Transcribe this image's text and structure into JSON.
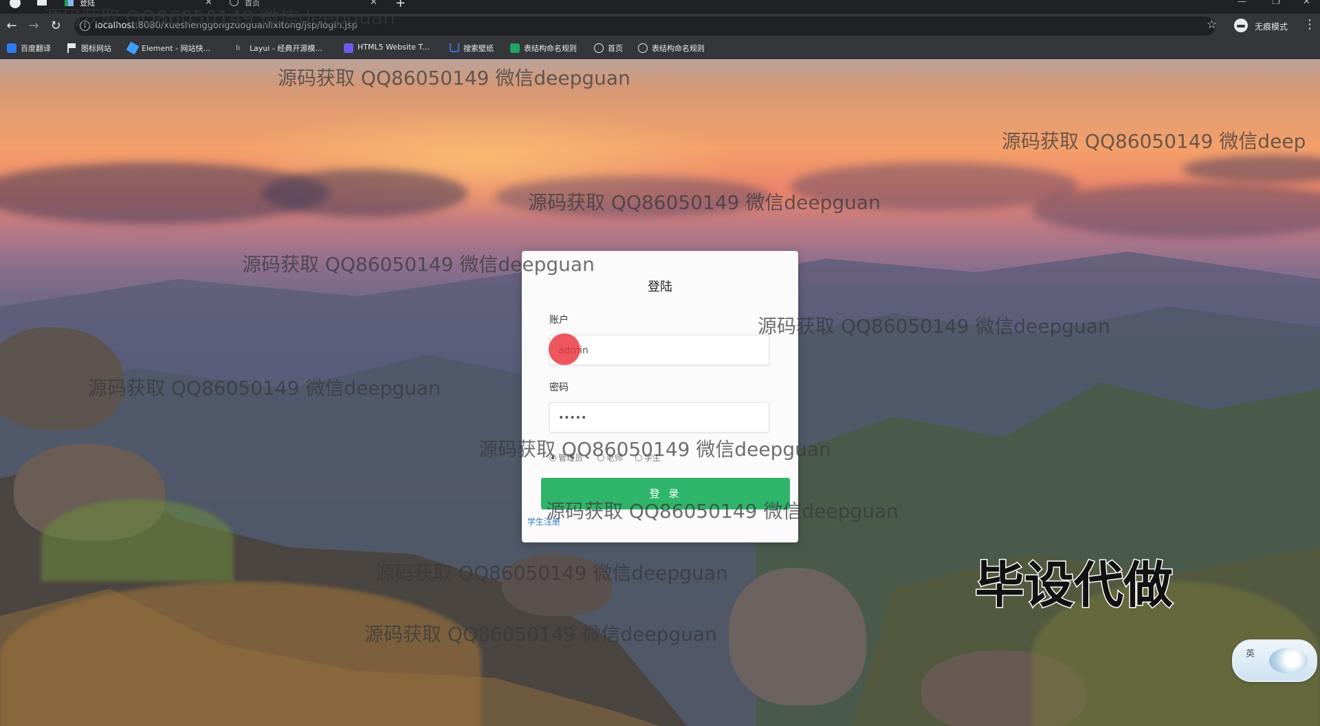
{
  "browser": {
    "tabs": [
      {
        "label": "登陆",
        "active": true
      },
      {
        "label": "首页",
        "active": false
      }
    ],
    "url_host": "localhost",
    "url_rest": ":8080/xueshenggongzuoguanlixitong/jsp/login.jsp",
    "incognito_label": "无痕模式",
    "bookmarks": [
      {
        "label": "百度翻译",
        "icon": "translate-icon",
        "color": "#2e7df6"
      },
      {
        "label": "图标网站",
        "icon": "flag-icon",
        "color": "#e8eaed"
      },
      {
        "label": "Element - 网站快...",
        "icon": "element-icon",
        "color": "#409eff"
      },
      {
        "label": "Layui - 经典开源模...",
        "icon": "layui-icon",
        "color": "#c8c8c8"
      },
      {
        "label": "HTML5 Website T...",
        "icon": "html5-icon",
        "color": "#6c5ce7"
      },
      {
        "label": "搜索壁纸",
        "icon": "wallpaper-icon",
        "color": "#3f6fd8"
      },
      {
        "label": "表结构命名规则",
        "icon": "sheet-icon",
        "color": "#1fa463"
      },
      {
        "label": "首页",
        "icon": "globe-icon",
        "color": "#e8eaed"
      },
      {
        "label": "表结构命名规则",
        "icon": "globe-icon",
        "color": "#e8eaed"
      }
    ]
  },
  "login": {
    "title": "登陆",
    "account_label": "账户",
    "account_value": "admin",
    "password_label": "密码",
    "password_value": "•••••",
    "roles": [
      {
        "label": "管理员",
        "checked": true
      },
      {
        "label": "老师",
        "checked": false
      },
      {
        "label": "学生",
        "checked": false
      }
    ],
    "submit_label": "登 录",
    "register_link": "学生注册"
  },
  "watermark_text": "源码获取 QQ86050149 微信deepguan",
  "watermark_text_cut": "源码获取 QQ86050149 微信deep",
  "overlay_text": "毕设代做",
  "ime_label": "英",
  "colors": {
    "login_button": "#2fb56a",
    "link": "#2d7fc8",
    "cursor_highlight": "#eb323c"
  }
}
